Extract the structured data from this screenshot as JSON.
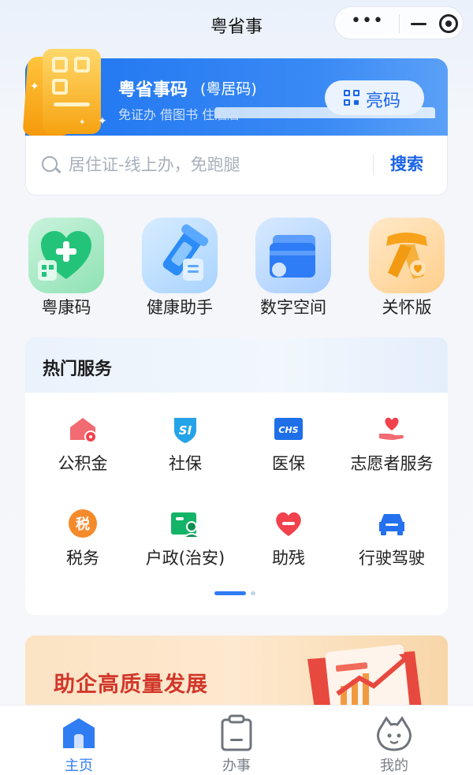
{
  "nav": {
    "title": "粤省事"
  },
  "code_banner": {
    "title": "粤省事码",
    "subtitle_label": "(粤居码)",
    "description": "免证办 借图书 住酒店",
    "button_label": "亮码"
  },
  "search": {
    "placeholder": "居住证-线上办，免跑腿",
    "button_label": "搜索"
  },
  "quick_entries": [
    {
      "label": "粤康码",
      "icon": "health-heart-icon"
    },
    {
      "label": "健康助手",
      "icon": "thermometer-icon"
    },
    {
      "label": "数字空间",
      "icon": "wallet-card-icon"
    },
    {
      "label": "关怀版",
      "icon": "scarf-icon"
    }
  ],
  "hot_services": {
    "title": "热门服务",
    "items": [
      {
        "label": "公积金",
        "icon": "house-icon"
      },
      {
        "label": "社保",
        "icon": "social-security-shield-icon",
        "badge": "SI"
      },
      {
        "label": "医保",
        "icon": "medical-insurance-card-icon",
        "badge": "CHS"
      },
      {
        "label": "志愿者服务",
        "icon": "heart-hand-icon"
      },
      {
        "label": "税务",
        "icon": "tax-coin-icon",
        "badge": "税"
      },
      {
        "label": "户政(治安)",
        "icon": "id-card-person-icon"
      },
      {
        "label": "助残",
        "icon": "heart-icon"
      },
      {
        "label": "行驶驾驶",
        "icon": "car-icon"
      }
    ]
  },
  "promo": {
    "title": "助企高质量发展"
  },
  "tabs": [
    {
      "label": "主页",
      "icon": "home-icon",
      "active": true
    },
    {
      "label": "办事",
      "icon": "clipboard-icon",
      "active": false
    },
    {
      "label": "我的",
      "icon": "profile-mascot-icon",
      "active": false
    }
  ],
  "colors": {
    "accent": "#1a64e6",
    "promo_text": "#d2372a",
    "tab_active": "#2f7cf3",
    "tab_inactive": "#7a7f88"
  }
}
